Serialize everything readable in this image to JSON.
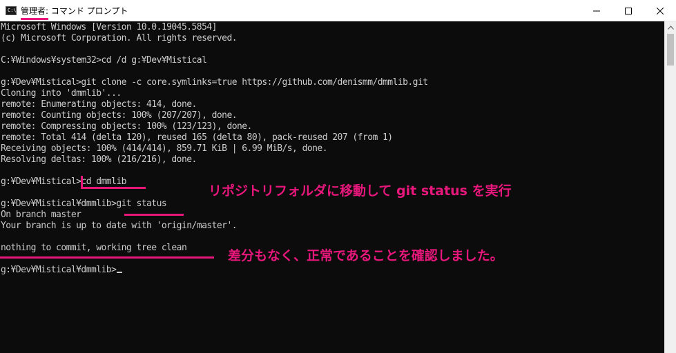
{
  "window": {
    "title": "管理者: コマンド プロンプト",
    "icon_text": "C:\\",
    "controls": {
      "minimize": "—",
      "maximize": "☐",
      "close": "✕"
    }
  },
  "console": {
    "lines": [
      "Microsoft Windows [Version 10.0.19045.5854]",
      "(c) Microsoft Corporation. All rights reserved.",
      "",
      "C:¥Windows¥system32>cd /d g:¥Dev¥Mistical",
      "",
      "g:¥Dev¥Mistical>git clone -c core.symlinks=true https://github.com/denismm/dmmlib.git",
      "Cloning into 'dmmlib'...",
      "remote: Enumerating objects: 414, done.",
      "remote: Counting objects: 100% (207/207), done.",
      "remote: Compressing objects: 100% (123/123), done.",
      "remote: Total 414 (delta 120), reused 165 (delta 80), pack-reused 207 (from 1)",
      "Receiving objects: 100% (414/414), 859.71 KiB | 6.99 MiB/s, done.",
      "Resolving deltas: 100% (216/216), done.",
      "",
      "g:¥Dev¥Mistical>cd dmmlib",
      "",
      "g:¥Dev¥Mistical¥dmmlib>git status",
      "On branch master",
      "Your branch is up to date with 'origin/master'.",
      "",
      "nothing to commit, working tree clean",
      "",
      "g:¥Dev¥Mistical¥dmmlib>"
    ]
  },
  "annotations": {
    "note_1": "リポジトリフォルダに移動して git status を実行",
    "note_2": "差分もなく、正常であることを確認しました。"
  },
  "colors": {
    "accent": "#e8177c",
    "console_bg": "#0c0c0c",
    "console_text": "#cccccc"
  },
  "icons": [
    "cmd-app-icon",
    "minimize-icon",
    "maximize-icon",
    "close-icon",
    "scroll-up-arrow-icon"
  ]
}
